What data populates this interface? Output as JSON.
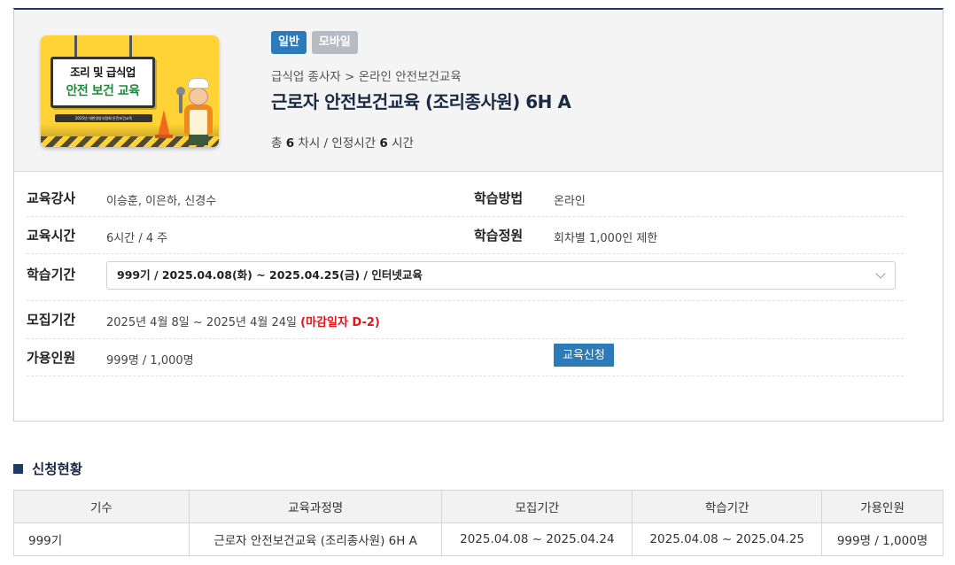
{
  "course": {
    "thumbnail": {
      "line1": "조리 및 급식업",
      "line2": "안전 보건 교육",
      "caption": "2025년 대한영양사협회 안전보건교육"
    },
    "badges": [
      "일반",
      "모바일"
    ],
    "breadcrumb": "급식업 종사자 > 온라인 안전보건교육",
    "title": "근로자 안전보건교육 (조리종사원) 6H A",
    "summary": {
      "prefix": "총",
      "sessions": "6",
      "sessions_unit": "차시 / 인정시간",
      "hours": "6",
      "hours_unit": "시간"
    }
  },
  "info": {
    "instructors_label": "교육강사",
    "instructors": "이승훈, 이은하, 신경수",
    "method_label": "학습방법",
    "method": "온라인",
    "duration_label": "교육시간",
    "duration": "6시간 / 4 주",
    "capacity_label": "학습정원",
    "capacity": "회차별 1,000인 제한",
    "period_label": "학습기간",
    "period_selected": "999기 / 2025.04.08(화) ~ 2025.04.25(금) / 인터넷교육",
    "recruit_label": "모집기간",
    "recruit": "2025년 4월 8일 ~ 2025년 4월 24일",
    "recruit_deadline": "(마감일자 D-2)",
    "available_label": "가용인원",
    "available": "999명 / 1,000명",
    "apply_button": "교육신청"
  },
  "status": {
    "title": "신청현황",
    "columns": [
      "기수",
      "교육과정명",
      "모집기간",
      "학습기간",
      "가용인원"
    ],
    "rows": [
      [
        "999기",
        "근로자 안전보건교육 (조리종사원) 6H A",
        "2025.04.08 ~ 2025.04.24",
        "2025.04.08 ~ 2025.04.25",
        "999명 / 1,000명"
      ]
    ]
  }
}
